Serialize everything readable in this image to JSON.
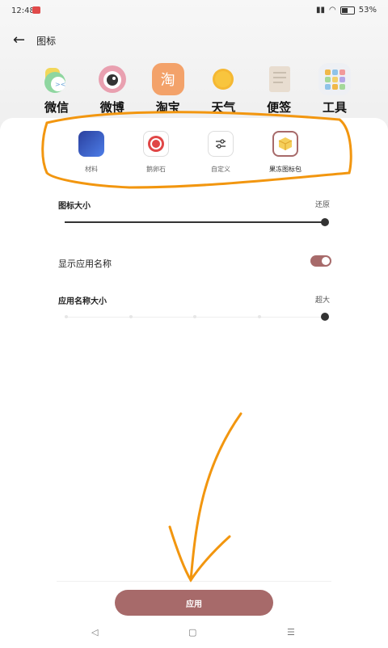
{
  "status": {
    "time": "12:48",
    "battery": "53%"
  },
  "header": {
    "title": "图标"
  },
  "preview_apps": [
    {
      "label": "微信",
      "icon": "wechat-icon"
    },
    {
      "label": "微博",
      "icon": "weibo-icon"
    },
    {
      "label": "淘宝",
      "icon": "taobao-icon",
      "glyph": "淘"
    },
    {
      "label": "天气",
      "icon": "weather-icon"
    },
    {
      "label": "便签",
      "icon": "notes-icon"
    },
    {
      "label": "工具",
      "icon": "tools-folder-icon"
    }
  ],
  "icon_styles": [
    {
      "label": "材料",
      "icon": "material-style-icon"
    },
    {
      "label": "鹅卵石",
      "icon": "pebble-style-icon"
    },
    {
      "label": "自定义",
      "icon": "custom-style-icon"
    },
    {
      "label": "果冻图标包",
      "icon": "jelly-pack-icon",
      "selected": true
    }
  ],
  "settings": {
    "icon_size_label": "图标大小",
    "icon_size_reset": "还原",
    "icon_size_value": 1.0,
    "show_name_label": "显示应用名称",
    "show_name_on": true,
    "name_size_label": "应用名称大小",
    "name_size_value_text": "超大",
    "name_size_value": 1.0
  },
  "apply_button": "应用",
  "colors": {
    "accent": "#a76a6a",
    "annotation": "#f2960f"
  },
  "navbar": {
    "back": "◁",
    "home": "▢",
    "recents": "☰"
  }
}
